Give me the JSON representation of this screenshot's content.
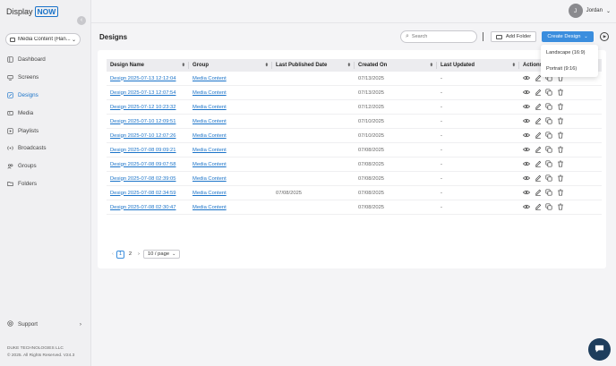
{
  "app": {
    "logo_display": "Display",
    "logo_now": "NOW"
  },
  "sidebar": {
    "workspace": "Media Content (Han...",
    "items": [
      {
        "label": "Dashboard",
        "icon": "dashboard-icon"
      },
      {
        "label": "Screens",
        "icon": "screens-icon"
      },
      {
        "label": "Designs",
        "icon": "designs-icon",
        "active": true
      },
      {
        "label": "Media",
        "icon": "media-icon"
      },
      {
        "label": "Playlists",
        "icon": "playlists-icon"
      },
      {
        "label": "Broadcasts",
        "icon": "broadcasts-icon"
      },
      {
        "label": "Groups",
        "icon": "groups-icon"
      },
      {
        "label": "Folders",
        "icon": "folders-icon"
      }
    ],
    "support": "Support",
    "company": "DUKE TECHNOLOGIES LLC",
    "copyright": "© 2025. All Rights Reserved. V24.3"
  },
  "user": {
    "initial": "J",
    "name": "Jordan"
  },
  "page": {
    "title": "Designs"
  },
  "toolbar": {
    "search_placeholder": "Search",
    "add_folder": "Add Folder",
    "create_design": "Create Design"
  },
  "create_menu": {
    "options": [
      "Landscape (16:9)",
      "Portrait (9:16)"
    ]
  },
  "table": {
    "columns": [
      "Design Name",
      "Group",
      "Last Published Date",
      "Created On",
      "Last Updated",
      "Actions"
    ],
    "rows": [
      {
        "name": "Design 2025-07-13 12:12:04",
        "group": "Media Content",
        "published": "",
        "created": "07/13/2025",
        "updated": "-"
      },
      {
        "name": "Design 2025-07-13 12:07:54",
        "group": "Media Content",
        "published": "",
        "created": "07/13/2025",
        "updated": "-"
      },
      {
        "name": "Design 2025-07-12 10:23:32",
        "group": "Media Content",
        "published": "",
        "created": "07/12/2025",
        "updated": "-"
      },
      {
        "name": "Design 2025-07-10 12:09:51",
        "group": "Media Content",
        "published": "",
        "created": "07/10/2025",
        "updated": "-"
      },
      {
        "name": "Design 2025-07-10 12:07:26",
        "group": "Media Content",
        "published": "",
        "created": "07/10/2025",
        "updated": "-"
      },
      {
        "name": "Design 2025-07-08 09:09:21",
        "group": "Media Content",
        "published": "",
        "created": "07/08/2025",
        "updated": "-"
      },
      {
        "name": "Design 2025-07-08 09:07:58",
        "group": "Media Content",
        "published": "",
        "created": "07/08/2025",
        "updated": "-"
      },
      {
        "name": "Design 2025-07-08 02:39:05",
        "group": "Media Content",
        "published": "",
        "created": "07/08/2025",
        "updated": "-"
      },
      {
        "name": "Design 2025-07-08 02:34:59",
        "group": "Media Content",
        "published": "07/08/2025",
        "created": "07/08/2025",
        "updated": "-"
      },
      {
        "name": "Design 2025-07-08 02:30:47",
        "group": "Media Content",
        "published": "",
        "created": "07/08/2025",
        "updated": "-"
      }
    ]
  },
  "pagination": {
    "pages": [
      "1",
      "2"
    ],
    "current": "1",
    "page_size": "10 / page"
  },
  "colors": {
    "accent": "#3b8ede",
    "link": "#1a73c9",
    "chat": "#1e3d5c"
  }
}
